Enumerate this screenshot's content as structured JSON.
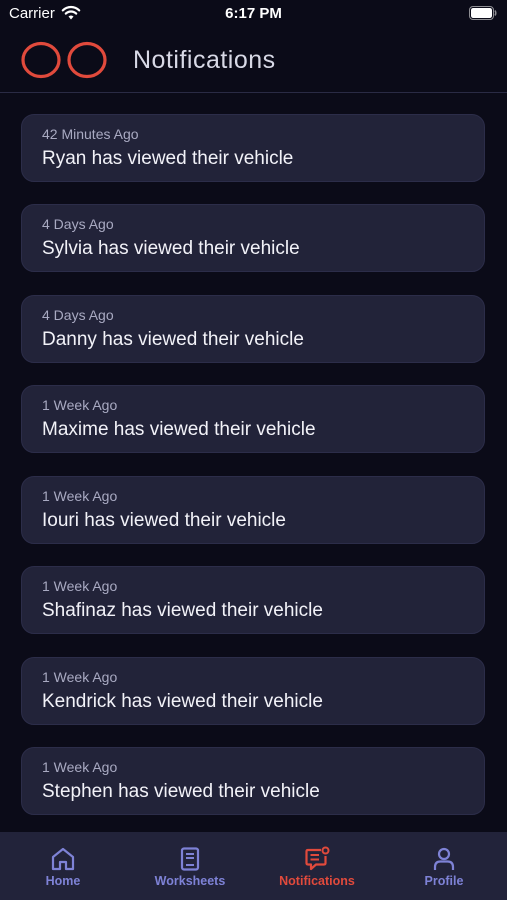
{
  "status_bar": {
    "carrier": "Carrier",
    "time": "6:17 PM"
  },
  "header": {
    "title": "Notifications",
    "logo_icon": "two-red-rings-logo"
  },
  "notifications": [
    {
      "time": "42 Minutes Ago",
      "message": "Ryan has viewed their vehicle"
    },
    {
      "time": "4 Days Ago",
      "message": "Sylvia has viewed their vehicle"
    },
    {
      "time": "4 Days Ago",
      "message": "Danny has viewed their vehicle"
    },
    {
      "time": "1 Week Ago",
      "message": "Maxime has viewed their vehicle"
    },
    {
      "time": "1 Week Ago",
      "message": "Iouri has viewed their vehicle"
    },
    {
      "time": "1 Week Ago",
      "message": "Shafinaz has viewed their vehicle"
    },
    {
      "time": "1 Week Ago",
      "message": "Kendrick has viewed their vehicle"
    },
    {
      "time": "1 Week Ago",
      "message": "Stephen has viewed their vehicle"
    }
  ],
  "tabbar": {
    "tabs": [
      {
        "label": "Home",
        "icon": "home-icon",
        "active": false
      },
      {
        "label": "Worksheets",
        "icon": "worksheet-icon",
        "active": false
      },
      {
        "label": "Notifications",
        "icon": "notification-icon",
        "active": true
      },
      {
        "label": "Profile",
        "icon": "profile-icon",
        "active": false
      }
    ]
  },
  "colors": {
    "background": "#0b0b18",
    "card": "#222339",
    "accent": "#e14a3c",
    "tab_inactive": "#7e82d6"
  }
}
